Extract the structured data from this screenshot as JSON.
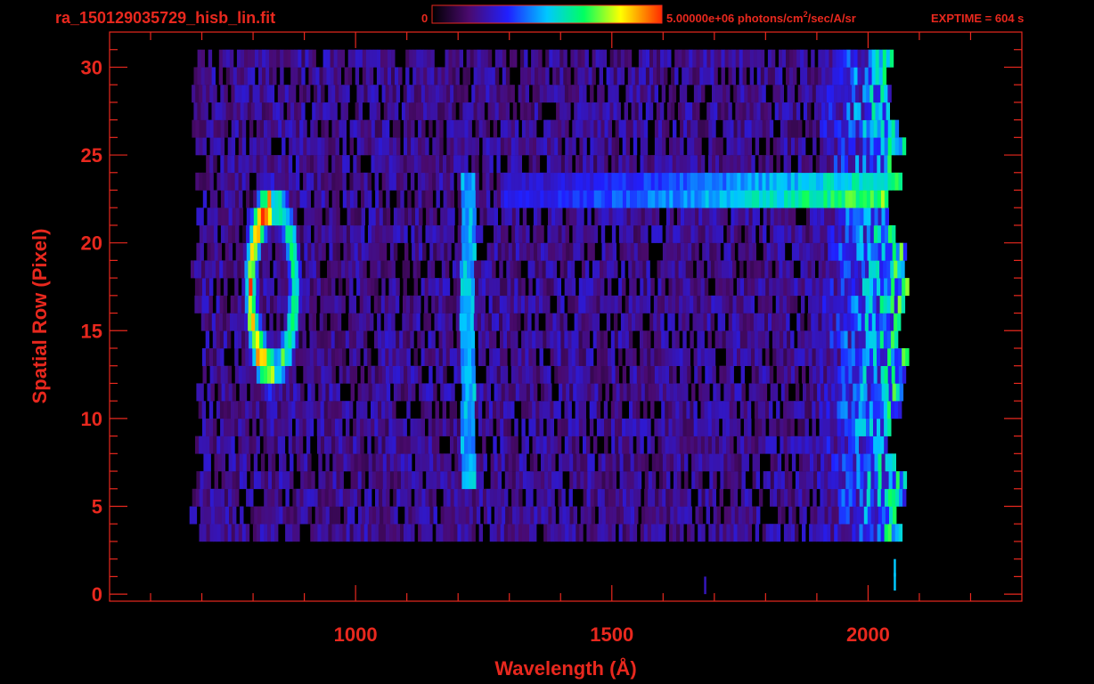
{
  "header": {
    "filename": "ra_150129035729_hisb_lin.fit",
    "colorbar_min_label": "0",
    "colorbar_max_label_pre": "5.00000e+06 photons/cm",
    "colorbar_max_label_sup": "2",
    "colorbar_max_label_post": "/sec/A/sr",
    "exptime_label": "EXPTIME = 604 s"
  },
  "colors": {
    "background": "#000000",
    "axis": "#e8281e",
    "colormap": [
      "#000000",
      "#4a0a6e",
      "#2020ff",
      "#00c8ff",
      "#00ff60",
      "#ffff00",
      "#ff2a00"
    ]
  },
  "chart_data": {
    "type": "heatmap",
    "title": "",
    "xlabel": "Wavelength (Å)",
    "ylabel": "Spatial Row (Pixel)",
    "xlim": [
      520,
      2300
    ],
    "ylim": [
      -0.4,
      32
    ],
    "x_ticks": [
      1000,
      1500,
      2000
    ],
    "y_ticks": [
      0,
      5,
      10,
      15,
      20,
      25,
      30
    ],
    "grid": false,
    "colorbar": {
      "min": 0,
      "max": 5000000,
      "units": "photons/cm^2/sec/A/sr"
    },
    "detector_extent": {
      "x_min": 690,
      "x_max": 2080,
      "rows": [
        3,
        30
      ]
    },
    "features": [
      {
        "name": "ring emission",
        "x_center": 835,
        "x_halfwidth": 55,
        "row_center": 17,
        "row_halfwidth": 6,
        "peak_level": 1.0
      },
      {
        "name": "vertical line",
        "x": 1215,
        "rows": [
          6,
          23
        ],
        "level": 0.5
      },
      {
        "name": "horizontal band",
        "x_range": [
          1280,
          2060
        ],
        "rows": [
          22,
          23
        ],
        "level_start": 0.3,
        "level_end": 0.75
      },
      {
        "name": "high noise edge",
        "x_range": [
          1900,
          2080
        ],
        "rows": [
          3,
          30
        ],
        "level": 0.45
      }
    ]
  }
}
